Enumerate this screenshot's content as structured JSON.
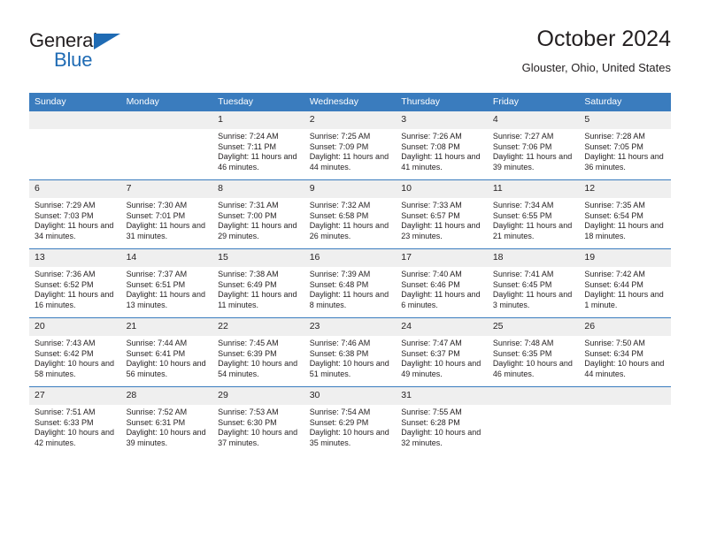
{
  "brand": {
    "name_part1": "General",
    "name_part2": "Blue",
    "triangle_icon": "triangle-icon",
    "accent_color": "#1f6bb4"
  },
  "header": {
    "title": "October 2024",
    "subtitle": "Glouster, Ohio, United States"
  },
  "theme": {
    "header_blue": "#3a7cbe",
    "daynum_gray": "#efefef",
    "text": "#231f20"
  },
  "weekday_headers": [
    "Sunday",
    "Monday",
    "Tuesday",
    "Wednesday",
    "Thursday",
    "Friday",
    "Saturday"
  ],
  "labels": {
    "sunrise_prefix": "Sunrise: ",
    "sunset_prefix": "Sunset: ",
    "daylight_prefix": "Daylight: "
  },
  "weeks": [
    [
      {
        "day": "",
        "sunrise": "",
        "sunset": "",
        "daylight": "",
        "empty": true
      },
      {
        "day": "",
        "sunrise": "",
        "sunset": "",
        "daylight": "",
        "empty": true
      },
      {
        "day": "1",
        "sunrise": "Sunrise: 7:24 AM",
        "sunset": "Sunset: 7:11 PM",
        "daylight": "Daylight: 11 hours and 46 minutes."
      },
      {
        "day": "2",
        "sunrise": "Sunrise: 7:25 AM",
        "sunset": "Sunset: 7:09 PM",
        "daylight": "Daylight: 11 hours and 44 minutes."
      },
      {
        "day": "3",
        "sunrise": "Sunrise: 7:26 AM",
        "sunset": "Sunset: 7:08 PM",
        "daylight": "Daylight: 11 hours and 41 minutes."
      },
      {
        "day": "4",
        "sunrise": "Sunrise: 7:27 AM",
        "sunset": "Sunset: 7:06 PM",
        "daylight": "Daylight: 11 hours and 39 minutes."
      },
      {
        "day": "5",
        "sunrise": "Sunrise: 7:28 AM",
        "sunset": "Sunset: 7:05 PM",
        "daylight": "Daylight: 11 hours and 36 minutes."
      }
    ],
    [
      {
        "day": "6",
        "sunrise": "Sunrise: 7:29 AM",
        "sunset": "Sunset: 7:03 PM",
        "daylight": "Daylight: 11 hours and 34 minutes."
      },
      {
        "day": "7",
        "sunrise": "Sunrise: 7:30 AM",
        "sunset": "Sunset: 7:01 PM",
        "daylight": "Daylight: 11 hours and 31 minutes."
      },
      {
        "day": "8",
        "sunrise": "Sunrise: 7:31 AM",
        "sunset": "Sunset: 7:00 PM",
        "daylight": "Daylight: 11 hours and 29 minutes."
      },
      {
        "day": "9",
        "sunrise": "Sunrise: 7:32 AM",
        "sunset": "Sunset: 6:58 PM",
        "daylight": "Daylight: 11 hours and 26 minutes."
      },
      {
        "day": "10",
        "sunrise": "Sunrise: 7:33 AM",
        "sunset": "Sunset: 6:57 PM",
        "daylight": "Daylight: 11 hours and 23 minutes."
      },
      {
        "day": "11",
        "sunrise": "Sunrise: 7:34 AM",
        "sunset": "Sunset: 6:55 PM",
        "daylight": "Daylight: 11 hours and 21 minutes."
      },
      {
        "day": "12",
        "sunrise": "Sunrise: 7:35 AM",
        "sunset": "Sunset: 6:54 PM",
        "daylight": "Daylight: 11 hours and 18 minutes."
      }
    ],
    [
      {
        "day": "13",
        "sunrise": "Sunrise: 7:36 AM",
        "sunset": "Sunset: 6:52 PM",
        "daylight": "Daylight: 11 hours and 16 minutes."
      },
      {
        "day": "14",
        "sunrise": "Sunrise: 7:37 AM",
        "sunset": "Sunset: 6:51 PM",
        "daylight": "Daylight: 11 hours and 13 minutes."
      },
      {
        "day": "15",
        "sunrise": "Sunrise: 7:38 AM",
        "sunset": "Sunset: 6:49 PM",
        "daylight": "Daylight: 11 hours and 11 minutes."
      },
      {
        "day": "16",
        "sunrise": "Sunrise: 7:39 AM",
        "sunset": "Sunset: 6:48 PM",
        "daylight": "Daylight: 11 hours and 8 minutes."
      },
      {
        "day": "17",
        "sunrise": "Sunrise: 7:40 AM",
        "sunset": "Sunset: 6:46 PM",
        "daylight": "Daylight: 11 hours and 6 minutes."
      },
      {
        "day": "18",
        "sunrise": "Sunrise: 7:41 AM",
        "sunset": "Sunset: 6:45 PM",
        "daylight": "Daylight: 11 hours and 3 minutes."
      },
      {
        "day": "19",
        "sunrise": "Sunrise: 7:42 AM",
        "sunset": "Sunset: 6:44 PM",
        "daylight": "Daylight: 11 hours and 1 minute."
      }
    ],
    [
      {
        "day": "20",
        "sunrise": "Sunrise: 7:43 AM",
        "sunset": "Sunset: 6:42 PM",
        "daylight": "Daylight: 10 hours and 58 minutes."
      },
      {
        "day": "21",
        "sunrise": "Sunrise: 7:44 AM",
        "sunset": "Sunset: 6:41 PM",
        "daylight": "Daylight: 10 hours and 56 minutes."
      },
      {
        "day": "22",
        "sunrise": "Sunrise: 7:45 AM",
        "sunset": "Sunset: 6:39 PM",
        "daylight": "Daylight: 10 hours and 54 minutes."
      },
      {
        "day": "23",
        "sunrise": "Sunrise: 7:46 AM",
        "sunset": "Sunset: 6:38 PM",
        "daylight": "Daylight: 10 hours and 51 minutes."
      },
      {
        "day": "24",
        "sunrise": "Sunrise: 7:47 AM",
        "sunset": "Sunset: 6:37 PM",
        "daylight": "Daylight: 10 hours and 49 minutes."
      },
      {
        "day": "25",
        "sunrise": "Sunrise: 7:48 AM",
        "sunset": "Sunset: 6:35 PM",
        "daylight": "Daylight: 10 hours and 46 minutes."
      },
      {
        "day": "26",
        "sunrise": "Sunrise: 7:50 AM",
        "sunset": "Sunset: 6:34 PM",
        "daylight": "Daylight: 10 hours and 44 minutes."
      }
    ],
    [
      {
        "day": "27",
        "sunrise": "Sunrise: 7:51 AM",
        "sunset": "Sunset: 6:33 PM",
        "daylight": "Daylight: 10 hours and 42 minutes."
      },
      {
        "day": "28",
        "sunrise": "Sunrise: 7:52 AM",
        "sunset": "Sunset: 6:31 PM",
        "daylight": "Daylight: 10 hours and 39 minutes."
      },
      {
        "day": "29",
        "sunrise": "Sunrise: 7:53 AM",
        "sunset": "Sunset: 6:30 PM",
        "daylight": "Daylight: 10 hours and 37 minutes."
      },
      {
        "day": "30",
        "sunrise": "Sunrise: 7:54 AM",
        "sunset": "Sunset: 6:29 PM",
        "daylight": "Daylight: 10 hours and 35 minutes."
      },
      {
        "day": "31",
        "sunrise": "Sunrise: 7:55 AM",
        "sunset": "Sunset: 6:28 PM",
        "daylight": "Daylight: 10 hours and 32 minutes."
      },
      {
        "day": "",
        "sunrise": "",
        "sunset": "",
        "daylight": "",
        "empty": true
      },
      {
        "day": "",
        "sunrise": "",
        "sunset": "",
        "daylight": "",
        "empty": true
      }
    ]
  ]
}
